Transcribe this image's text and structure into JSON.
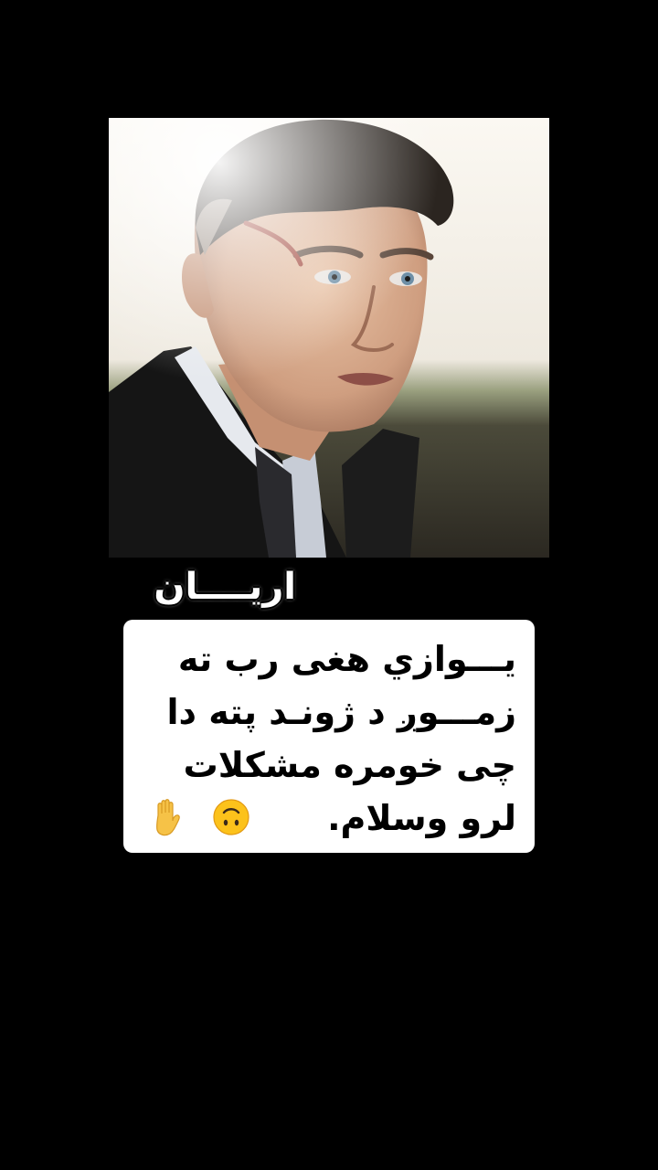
{
  "post": {
    "photo": {
      "description_icon": "portrait-photo",
      "palette": {
        "sky": "#f2efe8",
        "field": "#3b3a2c",
        "coat": "#151515",
        "shirt": "#d6dbe3"
      }
    },
    "signature": "اريــــان",
    "quote": {
      "lines": [
        "يـــوازي هغى رب ته",
        "زمـــوږ د ژونـد پته دا",
        "چى خومره مشكلات",
        "لرو وسلام."
      ],
      "icons": [
        "upside-down-face-icon",
        "raised-hand-icon"
      ]
    }
  }
}
